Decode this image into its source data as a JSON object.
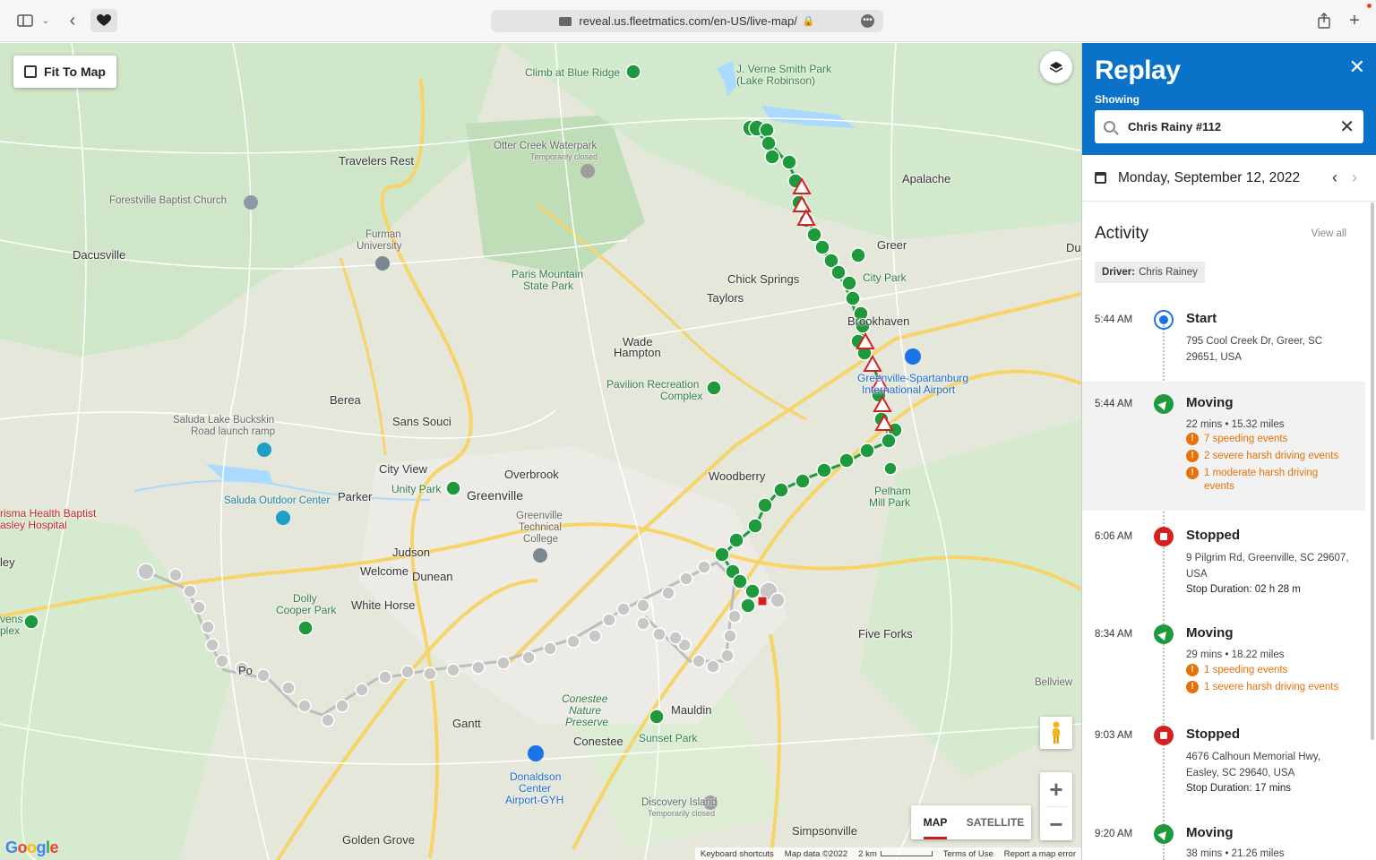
{
  "browser": {
    "url": "reveal.us.fleetmatics.com/en-US/live-map/"
  },
  "map": {
    "fit_button": "Fit To Map",
    "map_tab": "MAP",
    "satellite_tab": "SATELLITE",
    "google_logo": "Google",
    "attribution": {
      "keyboard": "Keyboard shortcuts",
      "map_data": "Map data ©2022",
      "scale": "2 km",
      "terms": "Terms of Use",
      "report": "Report a map error"
    },
    "places": {
      "travelers_rest": "Travelers Rest",
      "climb_blue_ridge": "Climb at Blue Ridge",
      "verne_smith_1": "J. Verne Smith Park",
      "verne_smith_2": "(Lake Robinson)",
      "otter_creek": "Otter Creek Waterpark",
      "otter_closed": "Temporarily closed",
      "apalache": "Apalache",
      "forestville": "Forestville Baptist Church",
      "furman_1": "Furman",
      "furman_2": "University",
      "dacusville": "Dacusville",
      "greer": "Greer",
      "paris_mtn_1": "Paris Mountain",
      "paris_mtn_2": "State Park",
      "chick_springs": "Chick Springs",
      "taylors": "Taylors",
      "city_park": "City Park",
      "brookhaven": "Brookhaven",
      "wade_hampton_1": "Wade",
      "wade_hampton_2": "Hampton",
      "gsp_1": "Greenville-Spartanburg",
      "gsp_2": "International Airport",
      "pavilion_1": "Pavilion Recreation",
      "pavilion_2": "Complex",
      "berea": "Berea",
      "sans_souci": "Sans Souci",
      "saluda_lake_1": "Saluda Lake Buckskin",
      "saluda_lake_2": "Road launch ramp",
      "city_view": "City View",
      "overbrook": "Overbrook",
      "woodberry": "Woodberry",
      "pelham_1": "Pelham",
      "pelham_2": "Mill Park",
      "unity_park": "Unity Park",
      "greenville": "Greenville",
      "parker": "Parker",
      "saluda_outdoor": "Saluda Outdoor Center",
      "prisma_1": "risma Health Baptist",
      "prisma_2": "asley Hospital",
      "gtc_1": "Greenville",
      "gtc_2": "Technical",
      "gtc_3": "College",
      "judson": "Judson",
      "welcome": "Welcome",
      "dunean": "Dunean",
      "ley": "ley",
      "dolly_1": "Dolly",
      "dolly_2": "Cooper Park",
      "white_horse": "White Horse",
      "five_forks": "Five Forks",
      "vens_1": "vens",
      "vens_2": "plex",
      "conestee_np_1": "Conestee",
      "conestee_np_2": "Nature",
      "conestee_np_3": "Preserve",
      "mauldin": "Mauldin",
      "bellview": "Bellview",
      "gantt": "Gantt",
      "conestee": "Conestee",
      "sunset_park": "Sunset Park",
      "donaldson_1": "Donaldson",
      "donaldson_2": "Center",
      "donaldson_3": "Airport-GYH",
      "discovery_1": "Discovery Island",
      "discovery_2": "Temporarily closed",
      "simpsonville": "Simpsonville",
      "golden_grove": "Golden Grove",
      "du": "Du",
      "po": "Po"
    }
  },
  "panel": {
    "title": "Replay",
    "showing_label": "Showing",
    "vehicle": "Chris Rainy #112",
    "date": "Monday, September 12, 2022",
    "activity_title": "Activity",
    "view_all": "View all",
    "driver_label": "Driver:",
    "driver_name": "Chris Rainey",
    "events": [
      {
        "time": "5:44 AM",
        "type": "start",
        "title": "Start",
        "lines": [
          "795 Cool Creek Dr, Greer, SC",
          "29651, USA"
        ]
      },
      {
        "time": "5:44 AM",
        "type": "moving",
        "title": "Moving",
        "lines": [
          "22 mins • 15.32 miles"
        ],
        "warnings": [
          "7 speeding events",
          "2 severe harsh driving events",
          "1 moderate harsh driving",
          "events"
        ]
      },
      {
        "time": "6:06 AM",
        "type": "stopped",
        "title": "Stopped",
        "lines": [
          "9 Pilgrim Rd, Greenville, SC 29607,",
          "USA",
          "Stop Duration: 02 h 28 m"
        ]
      },
      {
        "time": "8:34 AM",
        "type": "moving",
        "title": "Moving",
        "lines": [
          "29 mins • 18.22 miles"
        ],
        "warnings": [
          "1 speeding events",
          "1 severe harsh driving events"
        ]
      },
      {
        "time": "9:03 AM",
        "type": "stopped",
        "title": "Stopped",
        "lines": [
          "4676 Calhoun Memorial Hwy,",
          "Easley, SC 29640, USA",
          "Stop Duration: 17 mins"
        ]
      },
      {
        "time": "9:20 AM",
        "type": "moving",
        "title": "Moving",
        "lines": [
          "38 mins • 21.26 miles"
        ]
      }
    ]
  },
  "colors": {
    "brand_blue": "#0a72c9",
    "moving_green": "#1e9a3c",
    "stopped_red": "#d62020",
    "warning_orange": "#e8710a"
  }
}
